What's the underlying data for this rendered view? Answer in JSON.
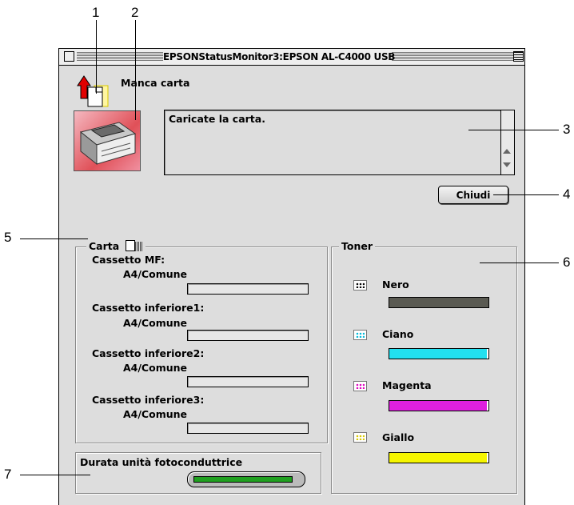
{
  "callouts": [
    "1",
    "2",
    "3",
    "4",
    "5",
    "6",
    "7"
  ],
  "window": {
    "title": "EPSONStatusMonitor3:EPSON AL-C4000 USB",
    "status_title": "Manca carta",
    "message": "Caricate la carta.",
    "close_button": "Chiudi"
  },
  "paper": {
    "group_label": "Carta",
    "trays": [
      {
        "name": "Cassetto MF:",
        "size": "A4/Comune"
      },
      {
        "name": "Cassetto inferiore1:",
        "size": "A4/Comune"
      },
      {
        "name": "Cassetto inferiore2:",
        "size": "A4/Comune"
      },
      {
        "name": "Cassetto inferiore3:",
        "size": "A4/Comune"
      }
    ]
  },
  "toner": {
    "group_label": "Toner",
    "items": [
      {
        "name": "Nero",
        "color": "#5a5a52",
        "level": 1.0
      },
      {
        "name": "Ciano",
        "color": "#22e0f0",
        "level": 0.98
      },
      {
        "name": "Magenta",
        "color": "#e020e0",
        "level": 0.98
      },
      {
        "name": "Giallo",
        "color": "#f5f500",
        "level": 0.98
      }
    ]
  },
  "photoconductor": {
    "label": "Durata unità fotoconduttrice",
    "level": 0.95,
    "color": "#20a020"
  }
}
